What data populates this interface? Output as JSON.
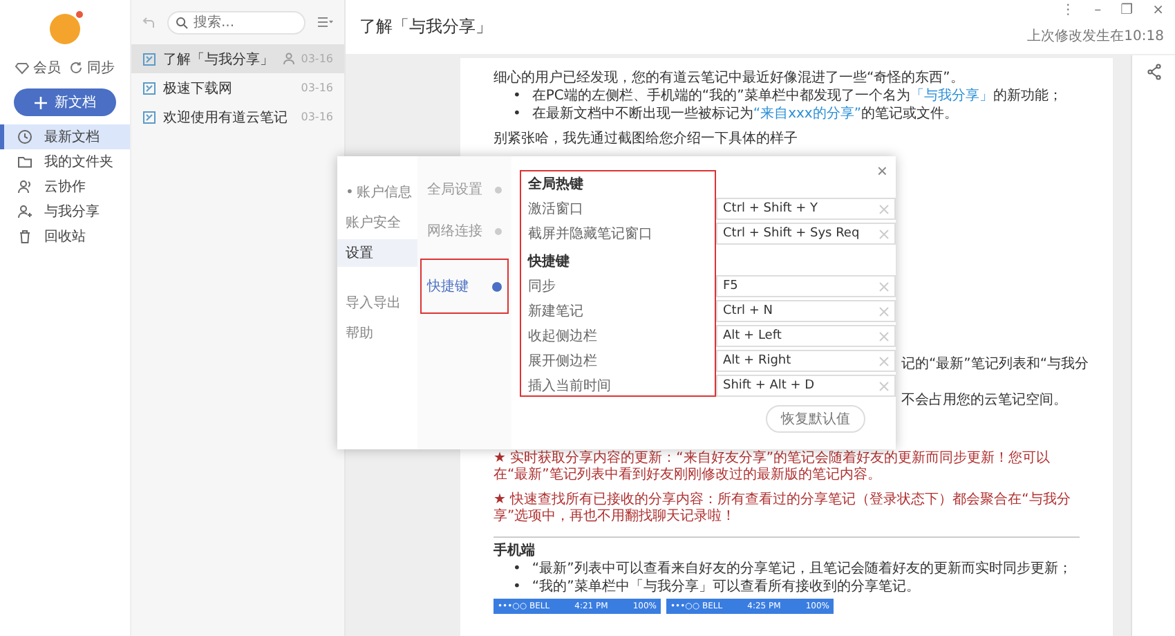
{
  "window": {
    "controls": [
      "⋮",
      "–",
      "❐",
      "×"
    ]
  },
  "sidebar": {
    "vip_label": "会员",
    "sync_label": "同步",
    "new_button": "新文档",
    "items": [
      {
        "label": "最新文档",
        "selected": true
      },
      {
        "label": "我的文件夹",
        "selected": false
      },
      {
        "label": "云协作",
        "selected": false
      },
      {
        "label": "与我分享",
        "selected": false
      },
      {
        "label": "回收站",
        "selected": false
      }
    ]
  },
  "note_list": {
    "search": {
      "placeholder": "搜索..."
    },
    "notes": [
      {
        "title": "了解「与我分享」",
        "date": "03-16",
        "shared": true,
        "selected": true
      },
      {
        "title": "极速下载网",
        "date": "03-16",
        "shared": false,
        "selected": false
      },
      {
        "title": "欢迎使用有道云笔记",
        "date": "03-16",
        "shared": false,
        "selected": false
      }
    ]
  },
  "editor": {
    "title": "了解「与我分享」",
    "last_modified": "上次修改发生在10:18",
    "blocks_above": [
      {
        "kind": "paragraph",
        "parts": [
          {
            "text": "细心的用户已经发现，您的有道云笔记中最近好像混进了一些“奇怪的东西”。",
            "highlight": false
          }
        ]
      },
      {
        "kind": "bullet",
        "marker": "•",
        "parts": [
          {
            "text": "在PC端的左侧栏、手机端的“我的”菜单栏中都发现了一个名为",
            "highlight": false
          },
          {
            "text": "「与我分享」",
            "highlight": true
          },
          {
            "text": "的新功能；",
            "highlight": false
          }
        ]
      },
      {
        "kind": "bullet",
        "marker": "•",
        "parts": [
          {
            "text": "在最新文档中不断出现一些被标记为",
            "highlight": false
          },
          {
            "text": "“来自xxx的分享”",
            "highlight": true
          },
          {
            "text": "的笔记或文件。",
            "highlight": false
          }
        ]
      },
      {
        "kind": "paragraph",
        "parts": [
          {
            "text": "别紧张哈，我先通过截图给您介绍一下具体的样子",
            "highlight": false
          }
        ]
      }
    ],
    "fragments_beside_dialog": [
      "记的“最新”笔记列表和“与我分",
      "不会占用您的云笔记空间。"
    ],
    "blocks_below": [
      {
        "kind": "notice",
        "parts": [
          {
            "text": "★ 实时获取分享内容的更新：“来自好友分享”的笔记会随着好友的更新而同步更新！您可以在“最新”笔记列表中看到好友刚刚修改过的最新版的笔记内容。",
            "highlight": false
          }
        ]
      },
      {
        "kind": "notice",
        "parts": [
          {
            "text": "★ 快速查找所有已接收的分享内容：所有查看过的分享笔记（登录状态下）都会聚合在“与我分享”选项中，再也不用翻找聊天记录啦！",
            "highlight": false
          }
        ]
      },
      {
        "kind": "heading",
        "parts": [
          {
            "text": "手机端",
            "highlight": false
          }
        ]
      },
      {
        "kind": "bullet",
        "marker": "•",
        "parts": [
          {
            "text": "“最新”列表中可以查看来自好友的分享笔记，且笔记会随着好友的更新而实时同步更新；",
            "highlight": false
          }
        ]
      },
      {
        "kind": "bullet",
        "marker": "•",
        "parts": [
          {
            "text": "“我的”菜单栏中「与我分享」可以查看所有接收到的分享笔记。",
            "highlight": false
          }
        ]
      },
      {
        "kind": "phones",
        "phones": [
          {
            "carrier": "•••○○ BELL",
            "time": "4:21 PM",
            "battery": "100%"
          },
          {
            "carrier": "•••○○ BELL",
            "time": "4:25 PM",
            "battery": "100%"
          }
        ]
      }
    ]
  },
  "settings_dialog": {
    "close": "×",
    "nav": [
      {
        "label": "账户信息",
        "marker": "•",
        "selected": false
      },
      {
        "label": "账户安全",
        "selected": false
      },
      {
        "label": "设置",
        "selected": true
      },
      {
        "label": "导入导出",
        "selected": false
      },
      {
        "label": "帮助",
        "selected": false
      }
    ],
    "sections": [
      {
        "label": "全局设置",
        "selected": false,
        "highlighted": false
      },
      {
        "label": "网络连接",
        "selected": false,
        "highlighted": false
      },
      {
        "label": "快捷键",
        "selected": true,
        "highlighted": true
      }
    ],
    "labels_highlighted": true,
    "groups": [
      {
        "heading": "全局热键",
        "rows": [
          {
            "label": "激活窗口",
            "value": "Ctrl + Shift + Y"
          },
          {
            "label": "截屏并隐藏笔记窗口",
            "value": "Ctrl + Shift + Sys Req"
          }
        ]
      },
      {
        "heading": "快捷键",
        "rows": [
          {
            "label": "同步",
            "value": "F5"
          },
          {
            "label": "新建笔记",
            "value": "Ctrl + N"
          },
          {
            "label": "收起侧边栏",
            "value": "Alt + Left"
          },
          {
            "label": "展开侧边栏",
            "value": "Alt + Right"
          },
          {
            "label": "插入当前时间",
            "value": "Shift + Alt + D"
          }
        ]
      }
    ],
    "reset_button": "恢复默认值"
  }
}
